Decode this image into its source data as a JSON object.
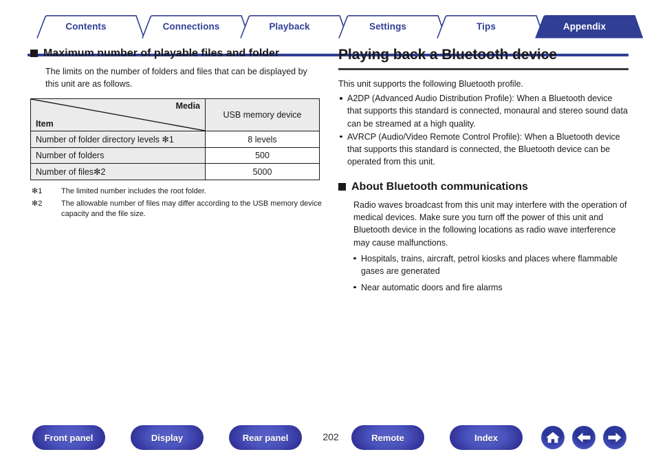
{
  "tabs": [
    {
      "label": "Contents",
      "active": false
    },
    {
      "label": "Connections",
      "active": false
    },
    {
      "label": "Playback",
      "active": false
    },
    {
      "label": "Settings",
      "active": false
    },
    {
      "label": "Tips",
      "active": false
    },
    {
      "label": "Appendix",
      "active": true
    }
  ],
  "colors": {
    "brand_blue": "#303f94",
    "tab_active_fill": "#303f94",
    "table_header_fill": "#ebebeb",
    "text": "#1a1a1a",
    "rule": "#3a3a3a"
  },
  "left": {
    "heading": "Maximum number of playable files and folder",
    "intro": "The limits on the number of folders and files that can be displayed by this unit are as follows.",
    "table": {
      "corner_top_right": "Media",
      "corner_bottom_left": "Item",
      "column_header": "USB memory device",
      "rows": [
        {
          "item": "Number of folder directory levels ✻1",
          "value": "8 levels"
        },
        {
          "item": "Number of folders",
          "value": "500"
        },
        {
          "item": "Number of files✻2",
          "value": "5000"
        }
      ]
    },
    "footnotes": [
      {
        "mark": "✻1",
        "text": "The limited number includes the root folder."
      },
      {
        "mark": "✻2",
        "text": "The allowable number of files may differ according to the USB memory device capacity and the file size."
      }
    ]
  },
  "right": {
    "title": "Playing back a Bluetooth device",
    "intro": "This unit supports the following Bluetooth profile.",
    "profiles": [
      "A2DP (Advanced Audio Distribution Profile): When a Bluetooth device that supports this standard is connected, monaural and stereo sound data can be streamed at a high quality.",
      "AVRCP (Audio/Video Remote Control Profile): When a Bluetooth device that supports this standard is connected, the Bluetooth device can be operated from this unit."
    ],
    "section_heading": "About Bluetooth communications",
    "section_body": "Radio waves broadcast from this unit may interfere with the operation of medical devices. Make sure you turn off the power of this unit and Bluetooth device in the following locations as radio wave interference may cause malfunctions.",
    "section_bullets": [
      "Hospitals, trains, aircraft, petrol kiosks and places where flammable gases are generated",
      "Near automatic doors and fire alarms"
    ]
  },
  "footer": {
    "buttons": [
      {
        "label": "Front panel"
      },
      {
        "label": "Display"
      },
      {
        "label": "Rear panel"
      },
      {
        "label": "Remote"
      },
      {
        "label": "Index"
      }
    ],
    "page_number": "202",
    "icon_buttons": [
      {
        "name": "home-icon"
      },
      {
        "name": "arrow-left-icon"
      },
      {
        "name": "arrow-right-icon"
      }
    ]
  }
}
